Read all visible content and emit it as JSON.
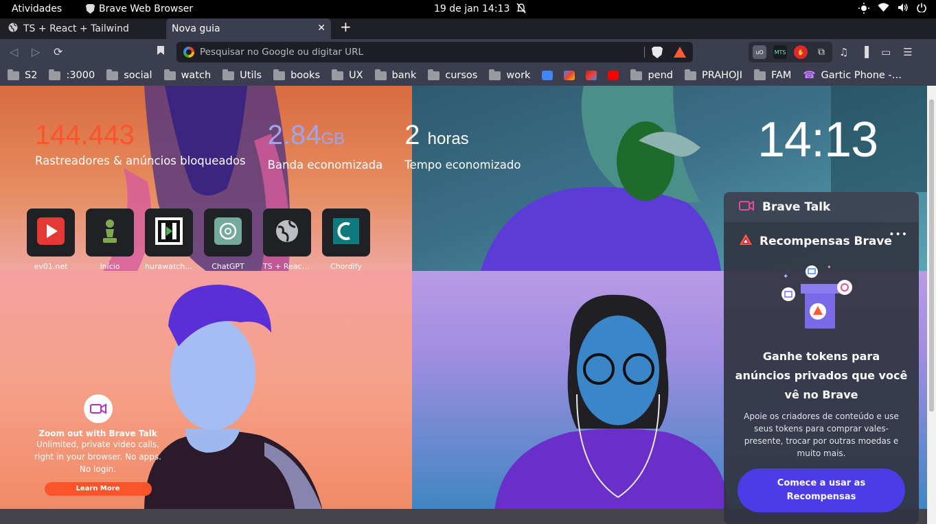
{
  "system_bar": {
    "activities": "Atividades",
    "app_name": "Brave Web Browser",
    "datetime": "19 de jan  14:13"
  },
  "tabs": [
    {
      "label": "TS + React + Tailwind",
      "active": false
    },
    {
      "label": "Nova guia",
      "active": true
    }
  ],
  "toolbar": {
    "url_placeholder": "Pesquisar no Google ou digitar URL",
    "ext_mts": "MTS"
  },
  "bookmarks": [
    {
      "label": "S2",
      "type": "folder"
    },
    {
      "label": ":3000",
      "type": "folder"
    },
    {
      "label": "social",
      "type": "folder"
    },
    {
      "label": "watch",
      "type": "folder"
    },
    {
      "label": "Utils",
      "type": "folder"
    },
    {
      "label": "books",
      "type": "folder"
    },
    {
      "label": "UX",
      "type": "folder"
    },
    {
      "label": "bank",
      "type": "folder"
    },
    {
      "label": "cursos",
      "type": "folder"
    },
    {
      "label": "work",
      "type": "folder"
    },
    {
      "label": "",
      "type": "favicon",
      "color": "#4285f4"
    },
    {
      "label": "",
      "type": "favicon",
      "color": "#ea4335"
    },
    {
      "label": "",
      "type": "favicon",
      "color": "#c5221f"
    },
    {
      "label": "",
      "type": "favicon",
      "color": "#ff0000"
    },
    {
      "label": "pend",
      "type": "folder"
    },
    {
      "label": "PRAHOJI",
      "type": "folder"
    },
    {
      "label": "FAM",
      "type": "folder"
    },
    {
      "label": "Gartic Phone -…",
      "type": "gartic"
    }
  ],
  "stats": {
    "trackers": {
      "value": "144.443",
      "unit": "",
      "label": "Rastreadores & anúncios bloqueados",
      "color": "#fb542b"
    },
    "bandwidth": {
      "value": "2.84",
      "unit": "GB",
      "label": "Banda economizada",
      "color": "#a0a5eb"
    },
    "time": {
      "value": "2",
      "unit": "horas",
      "label": "Tempo economizado",
      "color": "#ffffff"
    }
  },
  "clock": "14:13",
  "top_sites": [
    {
      "label": "ev01.net",
      "icon": "play-icon"
    },
    {
      "label": "Início",
      "icon": "chess-pawn-icon"
    },
    {
      "label": "hurawatch …",
      "icon": "h-icon"
    },
    {
      "label": "ChatGPT",
      "icon": "openai-icon"
    },
    {
      "label": "TS + React …",
      "icon": "globe-icon"
    },
    {
      "label": "Chordify",
      "icon": "chordify-icon"
    }
  ],
  "talk_promo": {
    "title": "Zoom out with Brave Talk",
    "description": "Unlimited, private video calls, right in your browser. No apps. No login.",
    "button": "Learn More"
  },
  "brave_talk": {
    "title": "Brave Talk"
  },
  "rewards": {
    "title": "Recompensas Brave",
    "more": "•••",
    "heading": "Ganhe tokens para anúncios privados que você vê no Brave",
    "text": "Apoie os criadores de conteúdo e use seus tokens para comprar vales-presente, trocar por outras moedas e muito mais.",
    "cta": "Comece a usar as Recompensas"
  }
}
